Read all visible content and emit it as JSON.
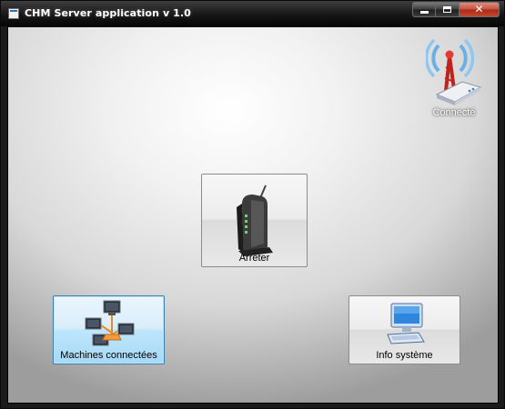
{
  "window": {
    "title": "CHM Server application v 1.0",
    "controls": {
      "minimize": "minimize",
      "maximize": "maximize",
      "close": "✕"
    }
  },
  "status": {
    "label": "Connecté",
    "icon": "router-signal-icon"
  },
  "buttons": {
    "stop": {
      "label": "Arrêter",
      "icon": "modem-icon"
    },
    "machines": {
      "label": "Machines connectées",
      "icon": "network-computers-icon"
    },
    "info": {
      "label": "Info système",
      "icon": "computer-icon"
    }
  },
  "colors": {
    "titlebar": "#161616",
    "close_button": "#c74f3c",
    "focus_border": "#3c7fb1",
    "signal_red": "#e23a32"
  }
}
